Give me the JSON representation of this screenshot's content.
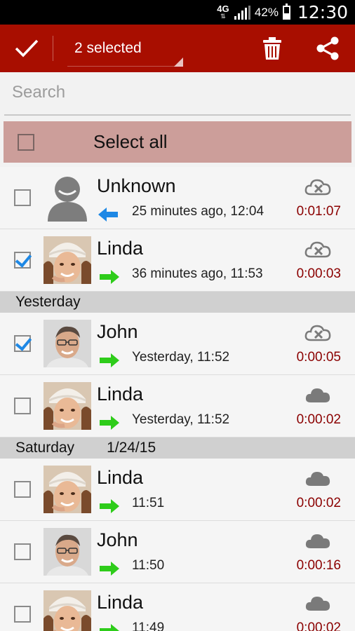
{
  "status": {
    "network": "4G",
    "battery_pct": "42%",
    "time": "12:30"
  },
  "actionbar": {
    "selected_label": "2 selected"
  },
  "search": {
    "placeholder": "Search"
  },
  "select_all": {
    "label": "Select all",
    "checked": false
  },
  "groups": [
    {
      "header": null,
      "items": [
        {
          "name": "Unknown",
          "time": "25 minutes ago, 12:04",
          "duration": "0:01:07",
          "direction": "incoming",
          "cloud": "cloud-off-icon",
          "checked": false,
          "avatar": "default-avatar"
        },
        {
          "name": "Linda",
          "time": "36 minutes ago, 11:53",
          "duration": "0:00:03",
          "direction": "outgoing",
          "cloud": "cloud-off-icon",
          "checked": true,
          "avatar": "linda-photo"
        }
      ]
    },
    {
      "header": {
        "day": "Yesterday",
        "date": ""
      },
      "items": [
        {
          "name": "John",
          "time": "Yesterday, 11:52",
          "duration": "0:00:05",
          "direction": "outgoing",
          "cloud": "cloud-off-icon",
          "checked": true,
          "avatar": "john-photo"
        },
        {
          "name": "Linda",
          "time": "Yesterday, 11:52",
          "duration": "0:00:02",
          "direction": "outgoing",
          "cloud": "cloud-icon",
          "checked": false,
          "avatar": "linda-photo"
        }
      ]
    },
    {
      "header": {
        "day": "Saturday",
        "date": "1/24/15"
      },
      "items": [
        {
          "name": "Linda",
          "time": "11:51",
          "duration": "0:00:02",
          "direction": "outgoing",
          "cloud": "cloud-icon",
          "checked": false,
          "avatar": "linda-photo"
        },
        {
          "name": "John",
          "time": "11:50",
          "duration": "0:00:16",
          "direction": "outgoing",
          "cloud": "cloud-icon",
          "checked": false,
          "avatar": "john-photo"
        },
        {
          "name": "Linda",
          "time": "11:49",
          "duration": "0:00:02",
          "direction": "outgoing",
          "cloud": "cloud-icon",
          "checked": false,
          "avatar": "linda-photo"
        }
      ]
    }
  ],
  "colors": {
    "actionbar": "#a80e00",
    "select_all_bg": "#cc9e9a",
    "duration": "#8b0000",
    "incoming_arrow": "#1e88e5",
    "outgoing_arrow": "#2ecc1a"
  }
}
